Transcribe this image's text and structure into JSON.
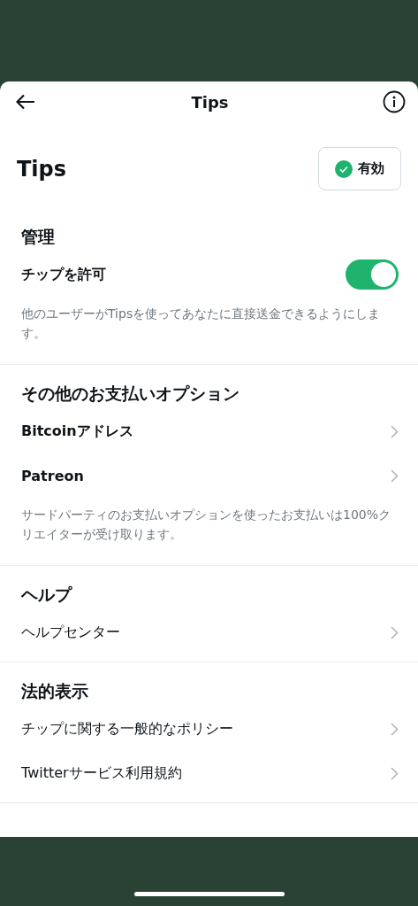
{
  "nav": {
    "title": "Tips"
  },
  "header": {
    "title": "Tips",
    "status": "有効"
  },
  "sections": [
    {
      "heading": "管理",
      "items": [
        {
          "kind": "toggle",
          "label": "チップを許可",
          "on": true
        }
      ],
      "note": "他のユーザーがTipsを使ってあなたに直接送金できるようにします。"
    },
    {
      "heading": "その他のお支払いオプション",
      "items": [
        {
          "kind": "option",
          "label": "Bitcoinアドレス"
        },
        {
          "kind": "option",
          "label": "Patreon"
        }
      ],
      "note": "サードパーティのお支払いオプションを使ったお支払いは100%クリエイターが受け取ります。"
    },
    {
      "heading": "ヘルプ",
      "items": [
        {
          "kind": "link",
          "label": "ヘルプセンター"
        }
      ]
    },
    {
      "heading": "法的表示",
      "items": [
        {
          "kind": "link",
          "label": "チップに関する一般的なポリシー"
        },
        {
          "kind": "link",
          "label": "Twitterサービス利用規約"
        }
      ]
    }
  ]
}
